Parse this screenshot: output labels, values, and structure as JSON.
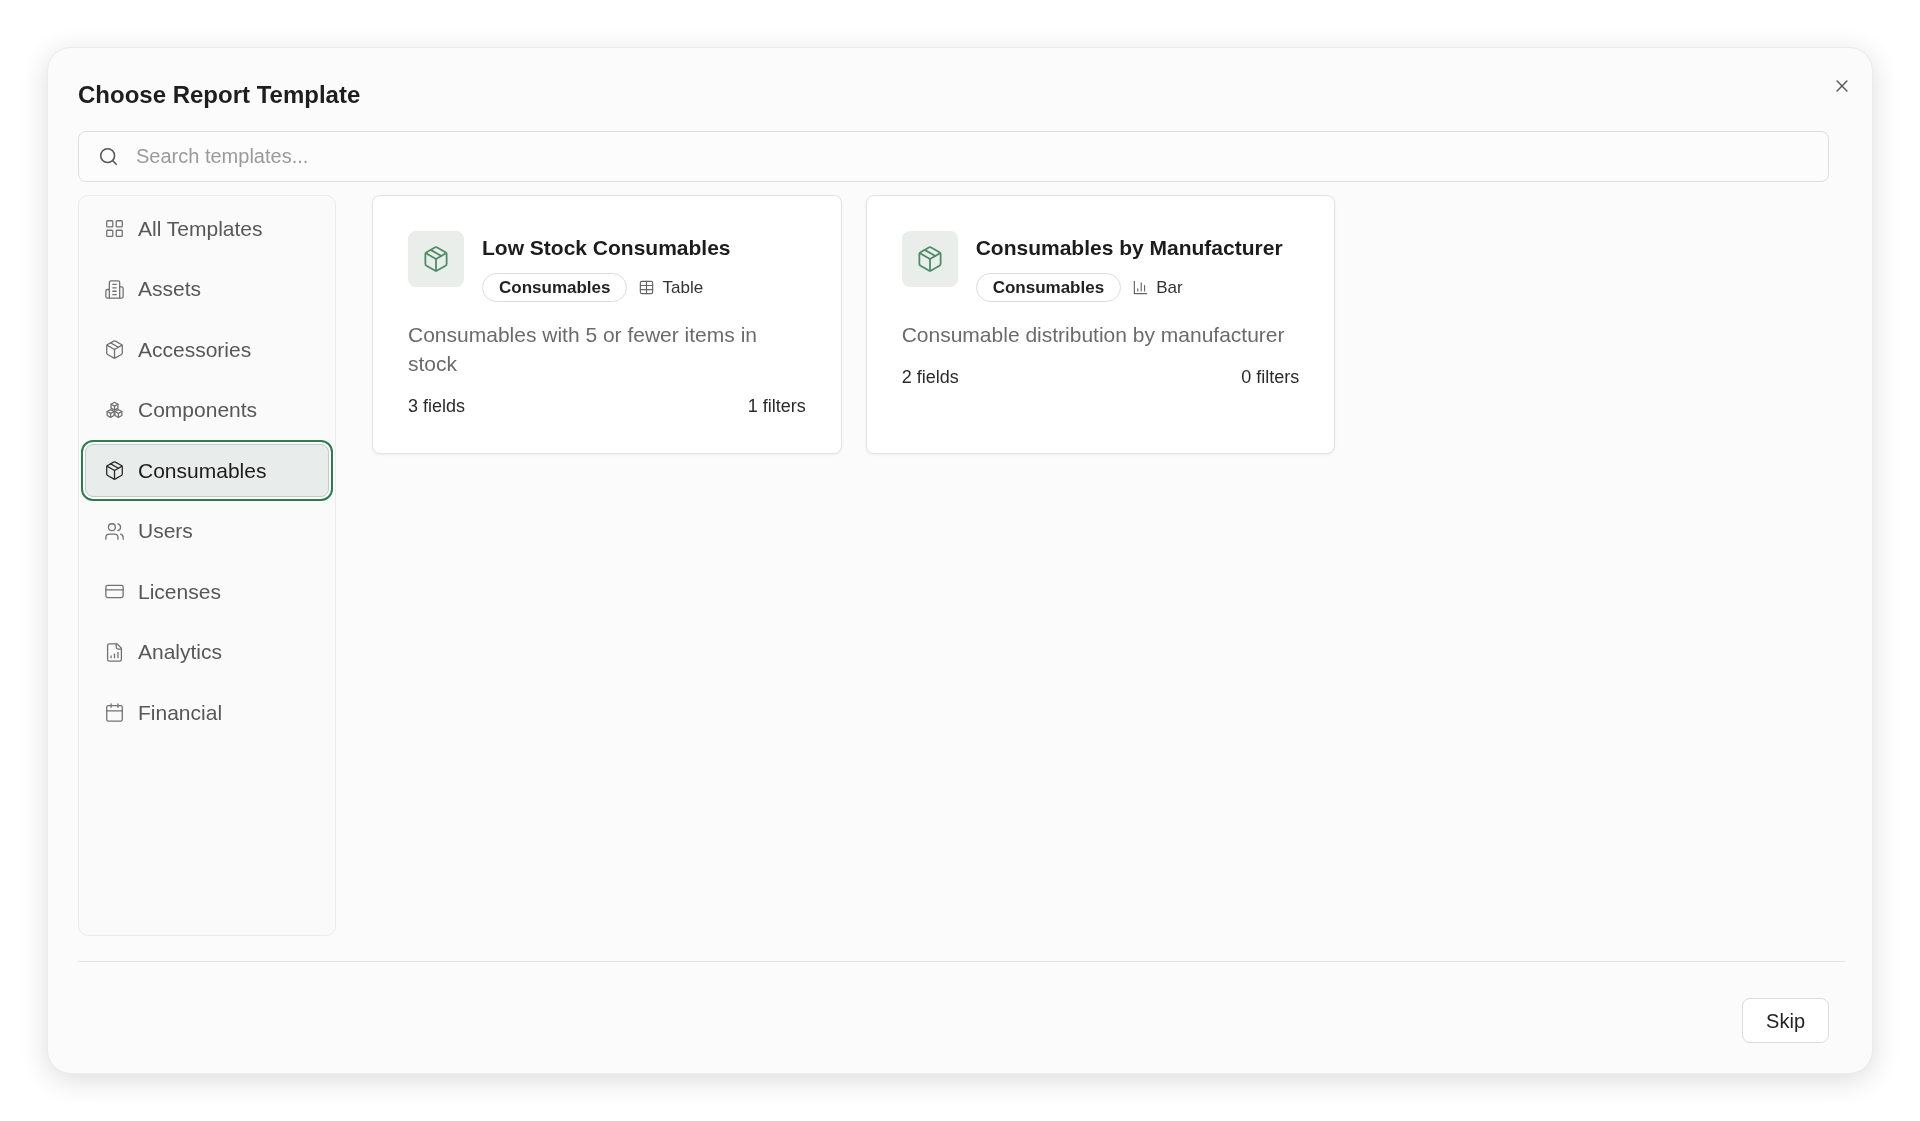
{
  "dialog": {
    "title": "Choose Report Template",
    "search": {
      "placeholder": "Search templates..."
    },
    "sidebar": {
      "items": [
        {
          "label": "All Templates",
          "selected": false
        },
        {
          "label": "Assets",
          "selected": false
        },
        {
          "label": "Accessories",
          "selected": false
        },
        {
          "label": "Components",
          "selected": false
        },
        {
          "label": "Consumables",
          "selected": true
        },
        {
          "label": "Users",
          "selected": false
        },
        {
          "label": "Licenses",
          "selected": false
        },
        {
          "label": "Analytics",
          "selected": false
        },
        {
          "label": "Financial",
          "selected": false
        }
      ]
    },
    "templates": [
      {
        "title": "Low Stock Consumables",
        "category": "Consumables",
        "chart_type": "Table",
        "description": "Consumables with 5 or fewer items in stock",
        "fields": "3 fields",
        "filters": "1 filters"
      },
      {
        "title": "Consumables by Manufacturer",
        "category": "Consumables",
        "chart_type": "Bar",
        "description": "Consumable distribution by manufacturer",
        "fields": "2 fields",
        "filters": "0 filters"
      }
    ],
    "buttons": [
      "Skip"
    ]
  }
}
